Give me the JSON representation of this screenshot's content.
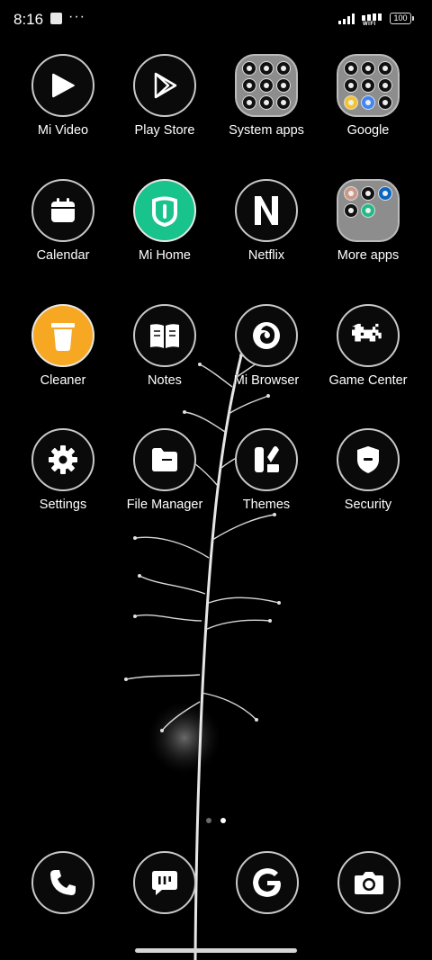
{
  "status_bar": {
    "time": "8:16",
    "wifi_label": "WIFI",
    "battery": "100"
  },
  "apps": {
    "row1": [
      "Mi Video",
      "Play Store",
      "System apps",
      "Google"
    ],
    "row2": [
      "Calendar",
      "Mi Home",
      "Netflix",
      "More apps"
    ],
    "row3": [
      "Cleaner",
      "Notes",
      "Mi Browser",
      "Game Center"
    ],
    "row4": [
      "Settings",
      "File Manager",
      "Themes",
      "Security"
    ]
  },
  "dock": {
    "items": [
      "phone-icon",
      "messages-icon",
      "google-icon",
      "camera-icon"
    ]
  },
  "pager": {
    "pages": 2,
    "current": 2
  },
  "colors": {
    "background": "#000000",
    "icon_ring": "#c9c9c9",
    "mi_home": "#19c38c",
    "cleaner": "#f7a823"
  }
}
